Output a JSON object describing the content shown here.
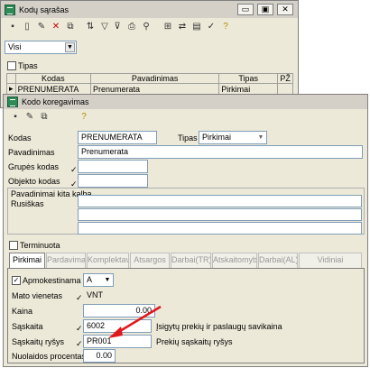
{
  "list_window": {
    "title": "Kodų sąrašas",
    "filter_value": "Visi",
    "tipas_label": "Tipas",
    "columns": [
      "Kodas",
      "Pavadinimas",
      "Tipas",
      "PŽ"
    ],
    "rows": [
      {
        "kodas": "PRENUMERATA",
        "pavadinimas": "Prenumerata",
        "tipas": "Pirkimai"
      }
    ]
  },
  "edit_window": {
    "title": "Kodo koregavimas",
    "fields": {
      "kodas_label": "Kodas",
      "kodas_value": "PRENUMERATA",
      "tipas_label": "Tipas",
      "tipas_value": "Pirkimai",
      "pavadinimas_label": "Pavadinimas",
      "pavadinimas_value": "Prenumerata",
      "grupes_label": "Grupės kodas",
      "objekto_label": "Objekto kodas",
      "kitos_kalbos_label": "Pavadinimai kita kalba",
      "rusiskas_label": "Rusiškas",
      "terminuota_label": "Terminuota"
    },
    "tabs": [
      "Pirkimai",
      "Pardavimai",
      "Komplektavi",
      "Atsargos",
      "Darbai(TR)",
      "Atskaitomybė",
      "Darbai(AL)",
      "Vidiniai"
    ],
    "pirkimai": {
      "apmokestinama_label": "Apmokestinama",
      "apmokestinama_value": "A",
      "mato_label": "Mato vienetas",
      "mato_value": "VNT",
      "kaina_label": "Kaina",
      "kaina_value": "0.00",
      "saskaita_label": "Sąskaita",
      "saskaita_value": "6002",
      "saskaita_desc": "Įsigytų prekių ir paslaugų savikaina",
      "rysys_label": "Sąskaitų ryšys",
      "rysys_value": "PR001",
      "rysys_desc": "Prekių sąskaitų ryšys",
      "nuolaidos_label": "Nuolaidos procentas",
      "nuolaidos_value": "0.00"
    }
  },
  "colors": {
    "annotation_arrow": "#e0181e",
    "title_icon": "#2e8b57"
  }
}
